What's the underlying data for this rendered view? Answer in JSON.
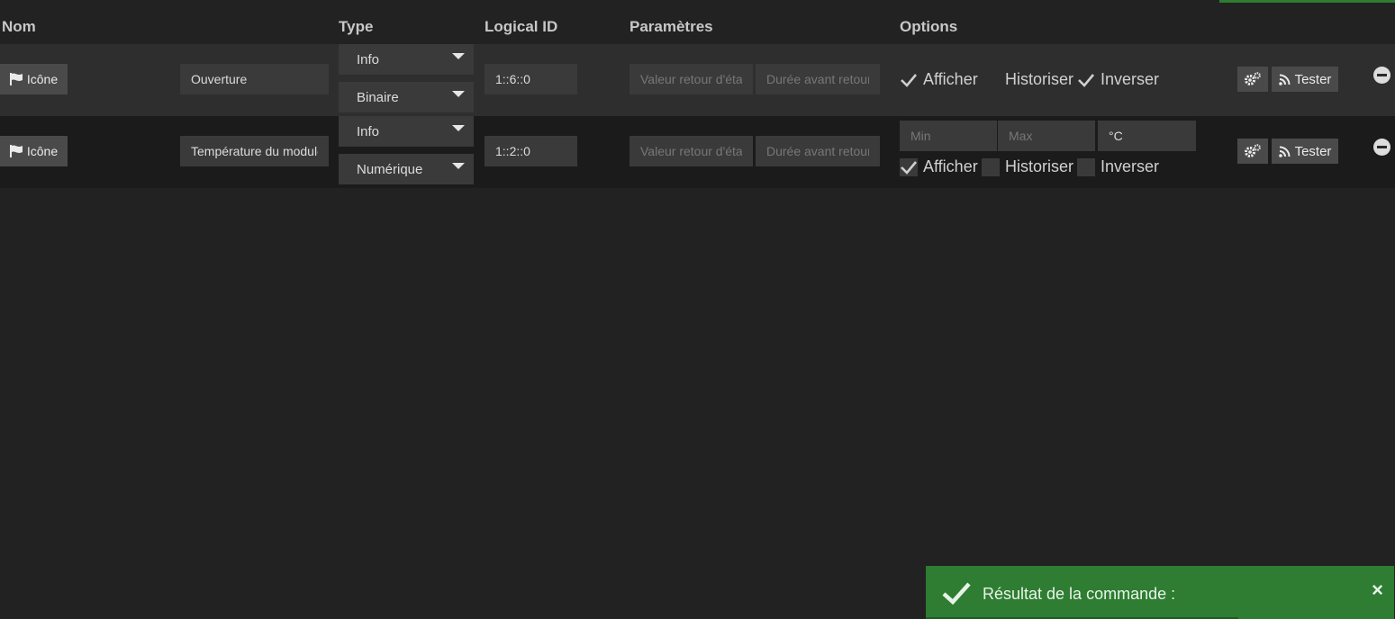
{
  "header": {
    "nom": "Nom",
    "type": "Type",
    "logical_id": "Logical ID",
    "parametres": "Paramètres",
    "options": "Options"
  },
  "rows": [
    {
      "icon_button": "Icône",
      "name": "Ouverture",
      "type1": "Info",
      "type2": "Binaire",
      "logical_id": "1::6::0",
      "param1_placeholder": "Valeur retour d'état",
      "param2_placeholder": "Durée avant retour",
      "options": {
        "afficher": "Afficher",
        "historiser": "Historiser",
        "inverser": "Inverser"
      },
      "checked": {
        "afficher": true,
        "historiser": false,
        "inverser": true
      },
      "test_button": "Tester"
    },
    {
      "icon_button": "Icône",
      "name": "Température du module",
      "type1": "Info",
      "type2": "Numérique",
      "logical_id": "1::2::0",
      "param1_placeholder": "Valeur retour d'état",
      "param2_placeholder": "Durée avant retour",
      "min_placeholder": "Min",
      "max_placeholder": "Max",
      "unit": "°C",
      "options": {
        "afficher": "Afficher",
        "historiser": "Historiser",
        "inverser": "Inverser"
      },
      "checked": {
        "afficher": true,
        "historiser": false,
        "inverser": false
      },
      "test_button": "Tester"
    }
  ],
  "toast": {
    "message": "Résultat de la commande :",
    "close": "×"
  },
  "colors": {
    "accent": "#2e7d32",
    "background": "#222222",
    "row_alt": "#2e2e2e"
  },
  "icons": [
    "flag-icon",
    "cogs-icon",
    "rss-icon",
    "minus-circle-icon",
    "check-icon",
    "close-icon"
  ]
}
